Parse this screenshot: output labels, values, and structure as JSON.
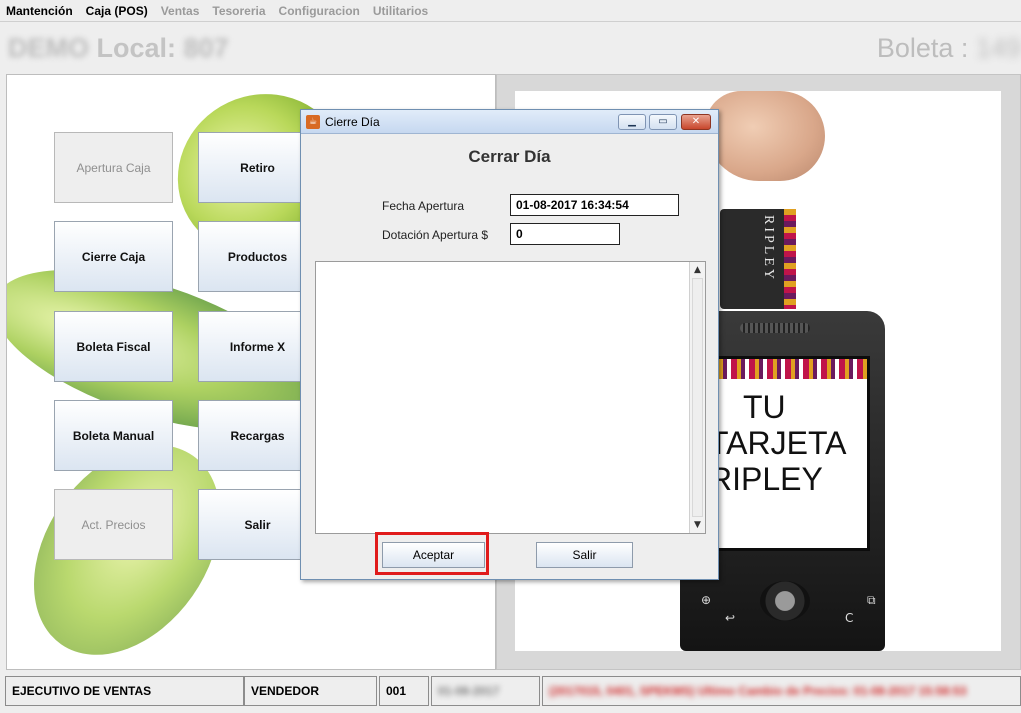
{
  "menu": {
    "items": [
      {
        "label": "Mantención",
        "enabled": true
      },
      {
        "label": "Caja (POS)",
        "enabled": true
      },
      {
        "label": "Ventas",
        "enabled": false
      },
      {
        "label": "Tesoreria",
        "enabled": false
      },
      {
        "label": "Configuracion",
        "enabled": false
      },
      {
        "label": "Utilitarios",
        "enabled": false
      }
    ]
  },
  "header": {
    "local_blurred": "DEMO",
    "local_label": "Local:",
    "local_number_blurred": "807",
    "boleta_label": "Boleta :",
    "boleta_number_blurred": "149"
  },
  "buttons": {
    "apertura_caja": "Apertura Caja",
    "retiro": "Retiro",
    "cierre_caja": "Cierre Caja",
    "productos": "Productos",
    "boleta_fiscal": "Boleta Fiscal",
    "informe_x": "Informe X",
    "boleta_manual": "Boleta Manual",
    "recargas": "Recargas",
    "act_precios": "Act. Precios",
    "salir": "Salir"
  },
  "ad": {
    "card_text": "RIPLEY",
    "screen_line1": "TU",
    "screen_line2": "TARJETA",
    "screen_line3": "RIPLEY"
  },
  "dialog": {
    "window_title": "Cierre Día",
    "heading": "Cerrar Día",
    "fecha_label": "Fecha Apertura",
    "fecha_value": "01-08-2017 16:34:54",
    "dotacion_label": "Dotación Apertura $",
    "dotacion_value": "0",
    "accept_label": "Aceptar",
    "exit_label": "Salir"
  },
  "status": {
    "role": "EJECUTIVO DE VENTAS",
    "user_type": "VENDEDOR",
    "code": "001",
    "date_blurred": "01-08-2017",
    "message_blurred": "(2017015, 0401, SPEKMS) Ultimo Cambio de Precios: 01-08-2017 15:58:53"
  },
  "colors": {
    "highlight": "#e01b1b",
    "button_gradient_bottom": "#dbe5f1",
    "titlebar": "#c6d8f0"
  }
}
